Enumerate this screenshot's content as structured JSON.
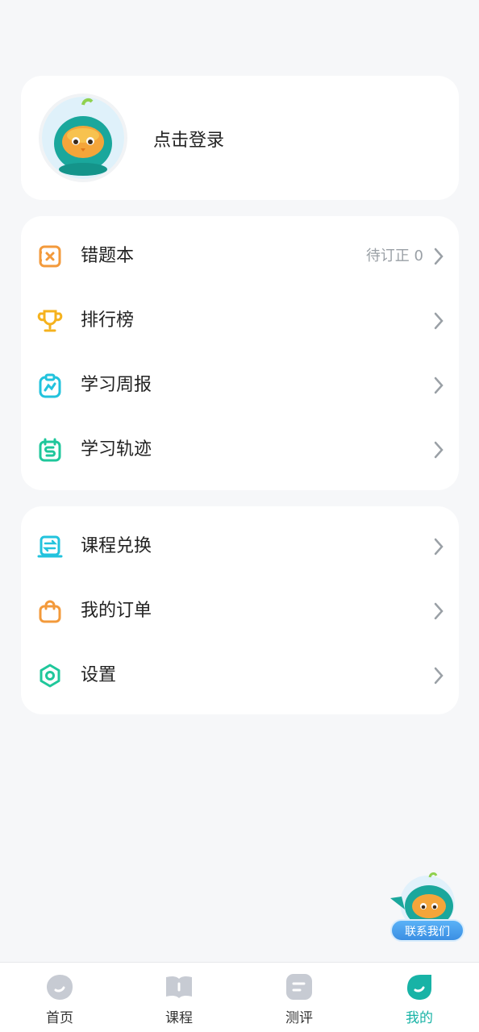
{
  "profile": {
    "login_text": "点击登录"
  },
  "menu_group_1": [
    {
      "label": "错题本",
      "badge": "待订正 0",
      "icon": "wrong-book-icon"
    },
    {
      "label": "排行榜",
      "badge": "",
      "icon": "trophy-icon"
    },
    {
      "label": "学习周报",
      "badge": "",
      "icon": "weekly-report-icon"
    },
    {
      "label": "学习轨迹",
      "badge": "",
      "icon": "learning-track-icon"
    }
  ],
  "menu_group_2": [
    {
      "label": "课程兑换",
      "icon": "exchange-icon"
    },
    {
      "label": "我的订单",
      "icon": "shopping-bag-icon"
    },
    {
      "label": "设置",
      "icon": "settings-icon"
    }
  ],
  "floating_help": {
    "label": "联系我们"
  },
  "tabbar": {
    "tabs": [
      {
        "label": "首页",
        "active": false
      },
      {
        "label": "课程",
        "active": false
      },
      {
        "label": "测评",
        "active": false
      },
      {
        "label": "我的",
        "active": true
      }
    ]
  },
  "colors": {
    "accent": "#18b3a6",
    "orange": "#f39a3b",
    "yellow": "#f5b21e",
    "cyan": "#22c3dd",
    "green": "#1fc79b",
    "inactive_tab": "#c7cbd3"
  }
}
